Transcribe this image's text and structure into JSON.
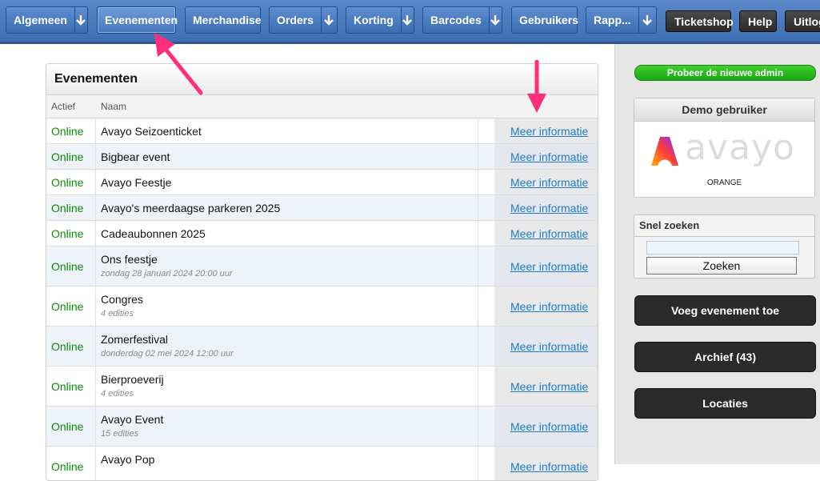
{
  "nav": {
    "items": [
      {
        "label": "Algemeen"
      },
      {
        "label": "Evenementen"
      },
      {
        "label": "Merchandise"
      },
      {
        "label": "Orders"
      },
      {
        "label": "Korting"
      },
      {
        "label": "Barcodes"
      },
      {
        "label": "Gebruikers"
      },
      {
        "label": "Rapp..."
      },
      {
        "label": "Ticketshop"
      },
      {
        "label": "Help"
      },
      {
        "label": "Uitlog"
      }
    ]
  },
  "events_panel": {
    "title": "Evenementen",
    "col_status": "Actief",
    "col_name": "Naam",
    "rows": [
      {
        "status": "Online",
        "name": "Avayo Seizoenticket",
        "sub": "",
        "link": "Meer informatie"
      },
      {
        "status": "Online",
        "name": "Bigbear event",
        "sub": "",
        "link": "Meer informatie"
      },
      {
        "status": "Online",
        "name": "Avayo Feestje",
        "sub": "",
        "link": "Meer informatie"
      },
      {
        "status": "Online",
        "name": "Avayo's meerdaagse parkeren 2025",
        "sub": "",
        "link": "Meer informatie"
      },
      {
        "status": "Online",
        "name": "Cadeaubonnen 2025",
        "sub": "",
        "link": "Meer informatie"
      },
      {
        "status": "Online",
        "name": "Ons feestje",
        "sub": "zondag 28 januari 2024 20:00 uur",
        "link": "Meer informatie"
      },
      {
        "status": "Online",
        "name": "Congres",
        "sub": "4 edities",
        "link": "Meer informatie"
      },
      {
        "status": "Online",
        "name": "Zomerfestival",
        "sub": "donderdag 02 mei 2024 12:00 uur",
        "link": "Meer informatie"
      },
      {
        "status": "Online",
        "name": "Bierproeverij",
        "sub": "4 edities",
        "link": "Meer informatie"
      },
      {
        "status": "Online",
        "name": "Avayo Event",
        "sub": "15 edities",
        "link": "Meer informatie"
      },
      {
        "status": "Online",
        "name": "Avayo Pop",
        "sub": "",
        "link": "Meer informatie"
      }
    ]
  },
  "sidebar": {
    "new_admin": "Probeer de nieuwe admin",
    "demo_title": "Demo gebruiker",
    "logo_text": "avayo",
    "org_name": "ORANGE",
    "search_title": "Snel zoeken",
    "search_value": "",
    "search_button": "Zoeken",
    "add_event": "Voeg evenement toe",
    "archive": "Archief (43)",
    "locations": "Locaties"
  },
  "colors": {
    "nav_blue": "#4a7bc0",
    "status_green": "#0a8a0a",
    "link_blue": "#1f7cc9",
    "annotation_pink": "#ff2d7a"
  }
}
